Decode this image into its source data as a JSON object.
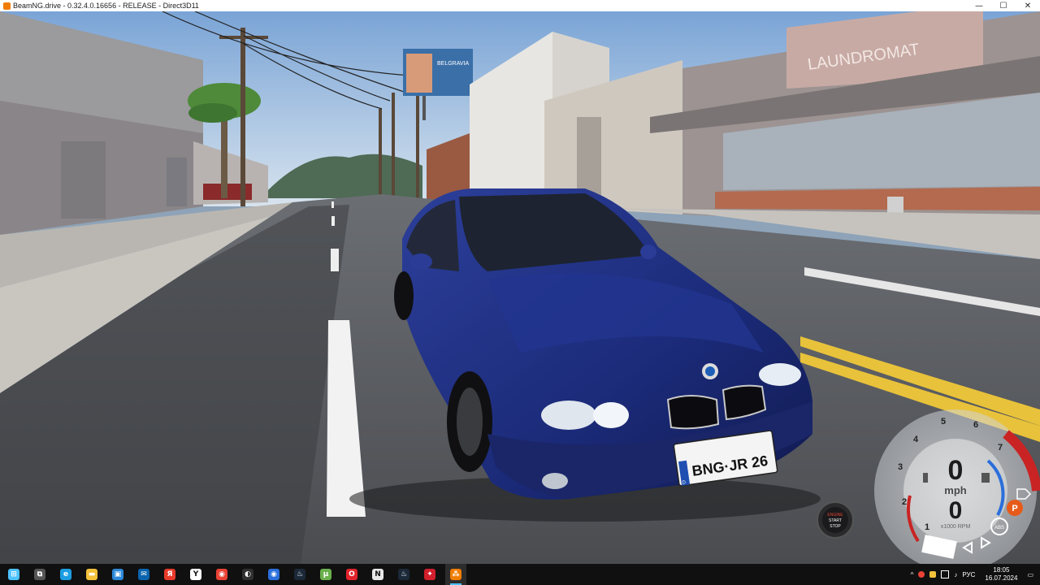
{
  "window": {
    "title": "BeamNG.drive - 0.32.4.0.16656 - RELEASE - Direct3D11",
    "minimize": "—",
    "maximize": "☐",
    "close": "✕"
  },
  "scene": {
    "laundromat_sign": "LAUNDROMAT",
    "license_plate": "BNG·JR 26",
    "plate_country": "D",
    "billboard_text": "BELGRAVIA"
  },
  "dashboard": {
    "gear": "0",
    "speed_unit": "mph",
    "rpm_value": "0",
    "rpm_unit": "x1000 RPM",
    "ticks": [
      "1",
      "2",
      "3",
      "4",
      "5",
      "6",
      "7"
    ],
    "engine_button_lines": [
      "ENGINE",
      "START",
      "STOP"
    ],
    "abs_label": "ABS",
    "parking_label": "P"
  },
  "taskbar": {
    "apps": [
      {
        "icon": "windows-icon",
        "color": "#4cc2ff",
        "glyph": "⊞"
      },
      {
        "icon": "task-view-icon",
        "color": "#555555",
        "glyph": "⧉"
      },
      {
        "icon": "edge-icon",
        "color": "#1b9de2",
        "glyph": "e"
      },
      {
        "icon": "file-explorer-icon",
        "color": "#f3c13a",
        "glyph": "▬"
      },
      {
        "icon": "store-icon",
        "color": "#2b88d8",
        "glyph": "▣"
      },
      {
        "icon": "mail-icon",
        "color": "#0a64ad",
        "glyph": "✉"
      },
      {
        "icon": "yandex-icon",
        "color": "#e83a2a",
        "glyph": "Я"
      },
      {
        "icon": "yandex-browser-icon",
        "color": "#ffffff",
        "glyph": "Y"
      },
      {
        "icon": "chrome-icon",
        "color": "#e94235",
        "glyph": "◉"
      },
      {
        "icon": "obs-icon",
        "color": "#303030",
        "glyph": "◐"
      },
      {
        "icon": "media-app-icon",
        "color": "#2a6fdb",
        "glyph": "◉"
      },
      {
        "icon": "steam-icon",
        "color": "#1b2838",
        "glyph": "♨"
      },
      {
        "icon": "utorrent-icon",
        "color": "#6ab04c",
        "glyph": "µ"
      },
      {
        "icon": "opera-icon",
        "color": "#e3232c",
        "glyph": "O"
      },
      {
        "icon": "notion-icon",
        "color": "#e8e8e8",
        "glyph": "N"
      },
      {
        "icon": "steam-icon-2",
        "color": "#1b2838",
        "glyph": "♨"
      },
      {
        "icon": "red-app-icon",
        "color": "#d11f2b",
        "glyph": "✦"
      },
      {
        "icon": "beamng-icon",
        "color": "#f07c00",
        "glyph": "⁂"
      }
    ],
    "active_index": 17,
    "tray": {
      "chevron": "^",
      "language": "РУС",
      "time": "18:05",
      "date": "16.07.2024",
      "notifications": "▭"
    }
  }
}
